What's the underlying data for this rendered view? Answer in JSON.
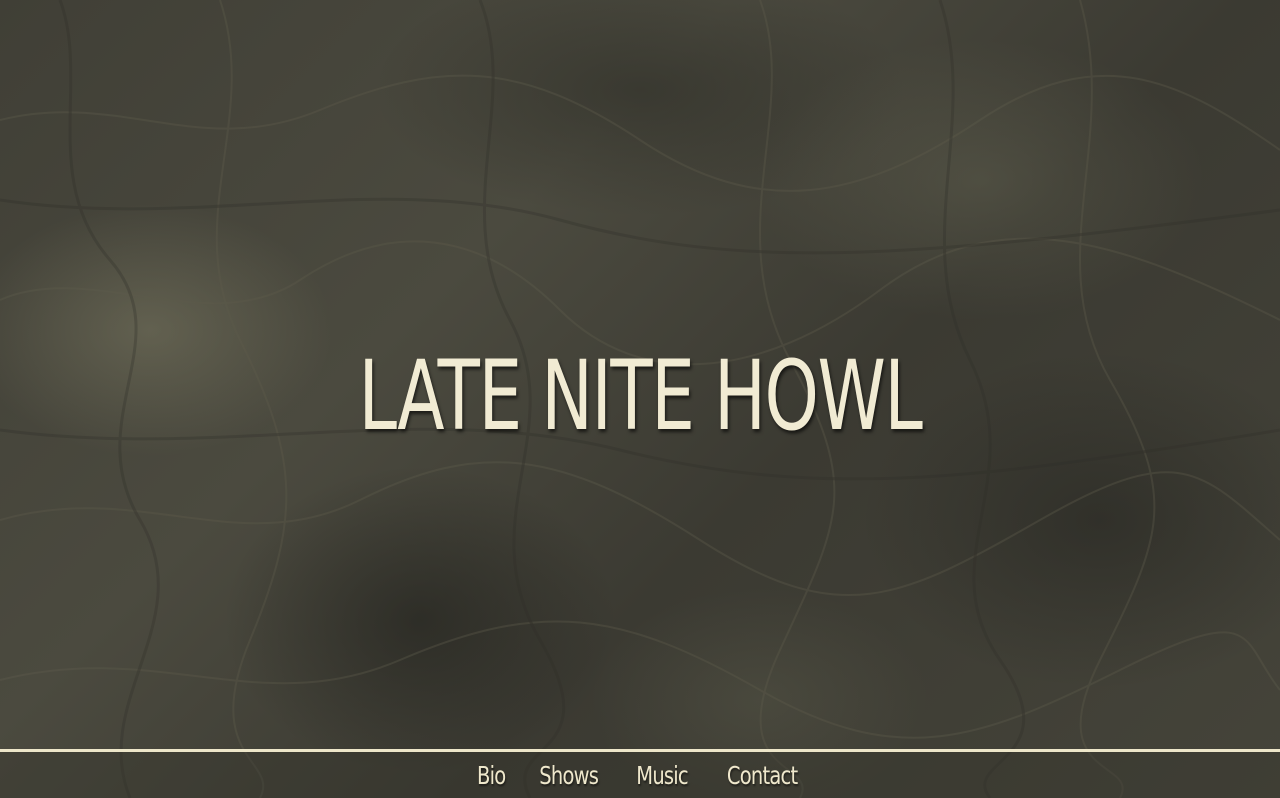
{
  "hero": {
    "title": "LATE NITE HOWL"
  },
  "nav": {
    "items": [
      {
        "label": "Bio"
      },
      {
        "label": "Shows"
      },
      {
        "label": "Music"
      },
      {
        "label": "Contact"
      }
    ]
  },
  "colors": {
    "background": "#45443a",
    "text": "#f1ebd3",
    "rule": "#ede6c9"
  }
}
